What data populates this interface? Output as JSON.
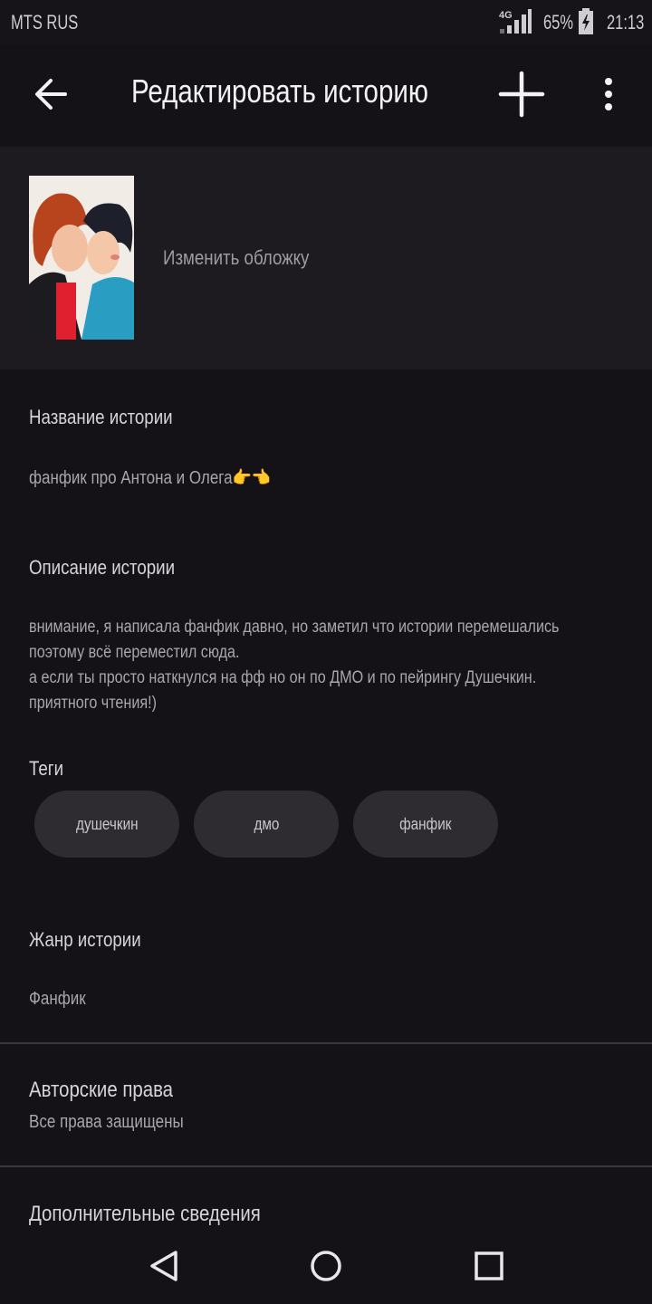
{
  "status_bar": {
    "carrier": "MTS RUS",
    "network": "4G",
    "battery": "65%",
    "time": "21:13"
  },
  "app_bar": {
    "title": "Редактировать историю",
    "back_icon": "arrow-left-icon",
    "add_icon": "plus-icon",
    "menu_icon": "more-vert-icon"
  },
  "cover": {
    "change_label": "Изменить обложку"
  },
  "story": {
    "title_label": "Название истории",
    "title_value": "фанфик про Антона и Олега👉👈",
    "description_label": "Описание истории",
    "description_value": "внимание, я написала фанфик давно, но заметил что истории перемешались поэтому всё переместил сюда.\nа если ты просто наткнулся на фф но он по ДМО и по пейрингу Душечкин. приятного чтения!)",
    "tags_label": "Теги",
    "tags": [
      "душечкин",
      "дмо",
      "фанфик"
    ],
    "genre_label": "Жанр истории",
    "genre_value": "Фанфик",
    "copyright_label": "Авторские права",
    "copyright_value": "Все права защищены",
    "extra_label": "Дополнительные сведения"
  },
  "nav_bar": {
    "back": "triangle-back-icon",
    "home": "circle-home-icon",
    "recents": "square-recents-icon"
  },
  "colors": {
    "background": "#141216",
    "cover_section": "#1d1b1f",
    "tag_chip": "#2e2c30"
  }
}
